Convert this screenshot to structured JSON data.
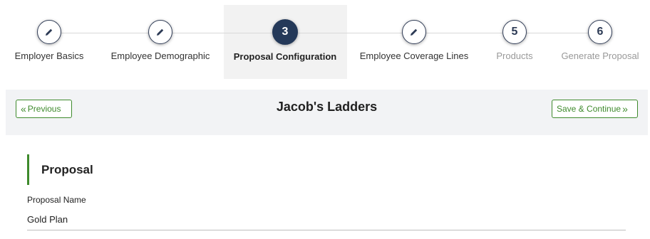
{
  "stepper": {
    "steps": [
      {
        "label": "Employer Basics",
        "state": "done",
        "icon": "pencil-icon"
      },
      {
        "label": "Employee Demographic",
        "state": "done",
        "icon": "pencil-icon"
      },
      {
        "label": "Proposal Configuration",
        "state": "active",
        "number": "3"
      },
      {
        "label": "Employee Coverage Lines",
        "state": "done",
        "icon": "pencil-icon"
      },
      {
        "label": "Products",
        "state": "pending",
        "number": "5"
      },
      {
        "label": "Generate Proposal",
        "state": "pending",
        "number": "6"
      }
    ]
  },
  "toolbar": {
    "title": "Jacob's Ladders",
    "previous_label": "Previous",
    "save_continue_label": "Save & Continue"
  },
  "proposal": {
    "heading": "Proposal",
    "name_label": "Proposal Name",
    "name_value": "Gold Plan"
  },
  "colors": {
    "accent_green": "#3e8a2c",
    "step_active": "#243959",
    "bar_bg": "#f2f3f5"
  }
}
